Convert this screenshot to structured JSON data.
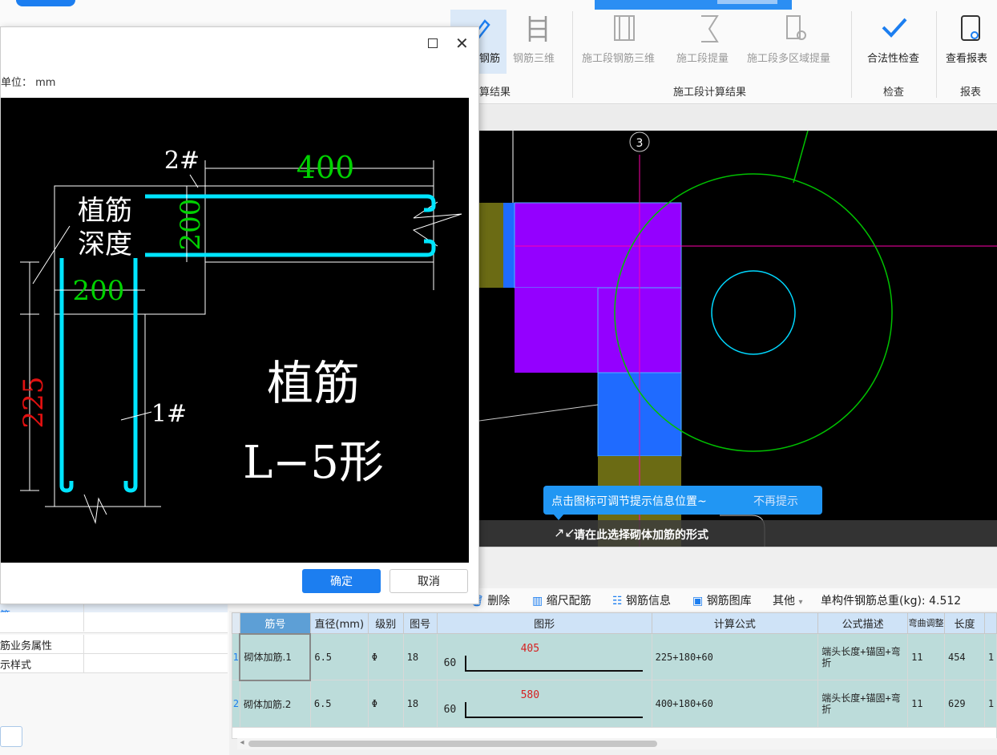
{
  "ribbon": {
    "buttons": {
      "rebar_label": "钢筋",
      "rebar_3d_label": "钢筋三维",
      "stage_rebar_3d_label": "施工段钢筋三维",
      "stage_quantity_label": "施工段提量",
      "stage_multi_area_label": "施工段多区域提量",
      "legality_check_label": "合法性检查",
      "view_report_label": "查看报表"
    },
    "groups": {
      "calc_result": "算结果",
      "stage_calc_result": "施工段计算结果",
      "check": "检查",
      "report": "报表"
    }
  },
  "dialog": {
    "unit_label": "单位： mm",
    "ok_label": "确定",
    "cancel_label": "取消",
    "drawing": {
      "bar2_label": "2#",
      "bar1_label": "1#",
      "dim_400": "400",
      "dim_200_vertical": "200",
      "dim_200_horizontal": "200",
      "dim_225": "225",
      "depth_label_line1": "植筋",
      "depth_label_line2": "深度",
      "title_line1": "植筋",
      "title_line2": "L−5形"
    }
  },
  "cad": {
    "axis_label": "3",
    "tip_text": "点击图标可调节提示信息位置~",
    "tip_dismiss": "不再提示",
    "hint_text": "请在此选择砌体加筋的形式"
  },
  "toolbar2": {
    "delete_label": "删除",
    "scale_rebar_label": "缩尺配筋",
    "rebar_info_label": "钢筋信息",
    "rebar_library_label": "钢筋图库",
    "other_label": "其他",
    "total_weight_label": "单构件钢筋总重(kg): 4.512"
  },
  "grid": {
    "headers": [
      "筋号",
      "直径(mm)",
      "级别",
      "图号",
      "图形",
      "计算公式",
      "公式描述",
      "弯曲调整",
      "长度"
    ],
    "rows": [
      {
        "idx": "1",
        "name": "砌体加筋.1",
        "dia": "6.5",
        "grade": "Φ",
        "fig": "18",
        "left": "60",
        "span": "405",
        "formula": "225+180+60",
        "desc": "端头长度+锚固+弯折",
        "bend": "11",
        "len": "454"
      },
      {
        "idx": "2",
        "name": "砌体加筋.2",
        "dia": "6.5",
        "grade": "Φ",
        "fig": "18",
        "left": "60",
        "span": "580",
        "formula": "400+180+60",
        "desc": "端头长度+锚固+弯折",
        "bend": "11",
        "len": "629"
      }
    ]
  },
  "left_panel": {
    "rows": [
      "筋",
      "",
      "筋业务属性",
      "示样式"
    ]
  },
  "colors": {
    "accent": "#1c7ef0",
    "rebar_cyan": "#00e5ff",
    "dim_green": "#00d200",
    "dim_red": "#e01010",
    "purple": "#9400ff",
    "olive": "#6b6b14",
    "blue_fill": "#1f6bff"
  }
}
